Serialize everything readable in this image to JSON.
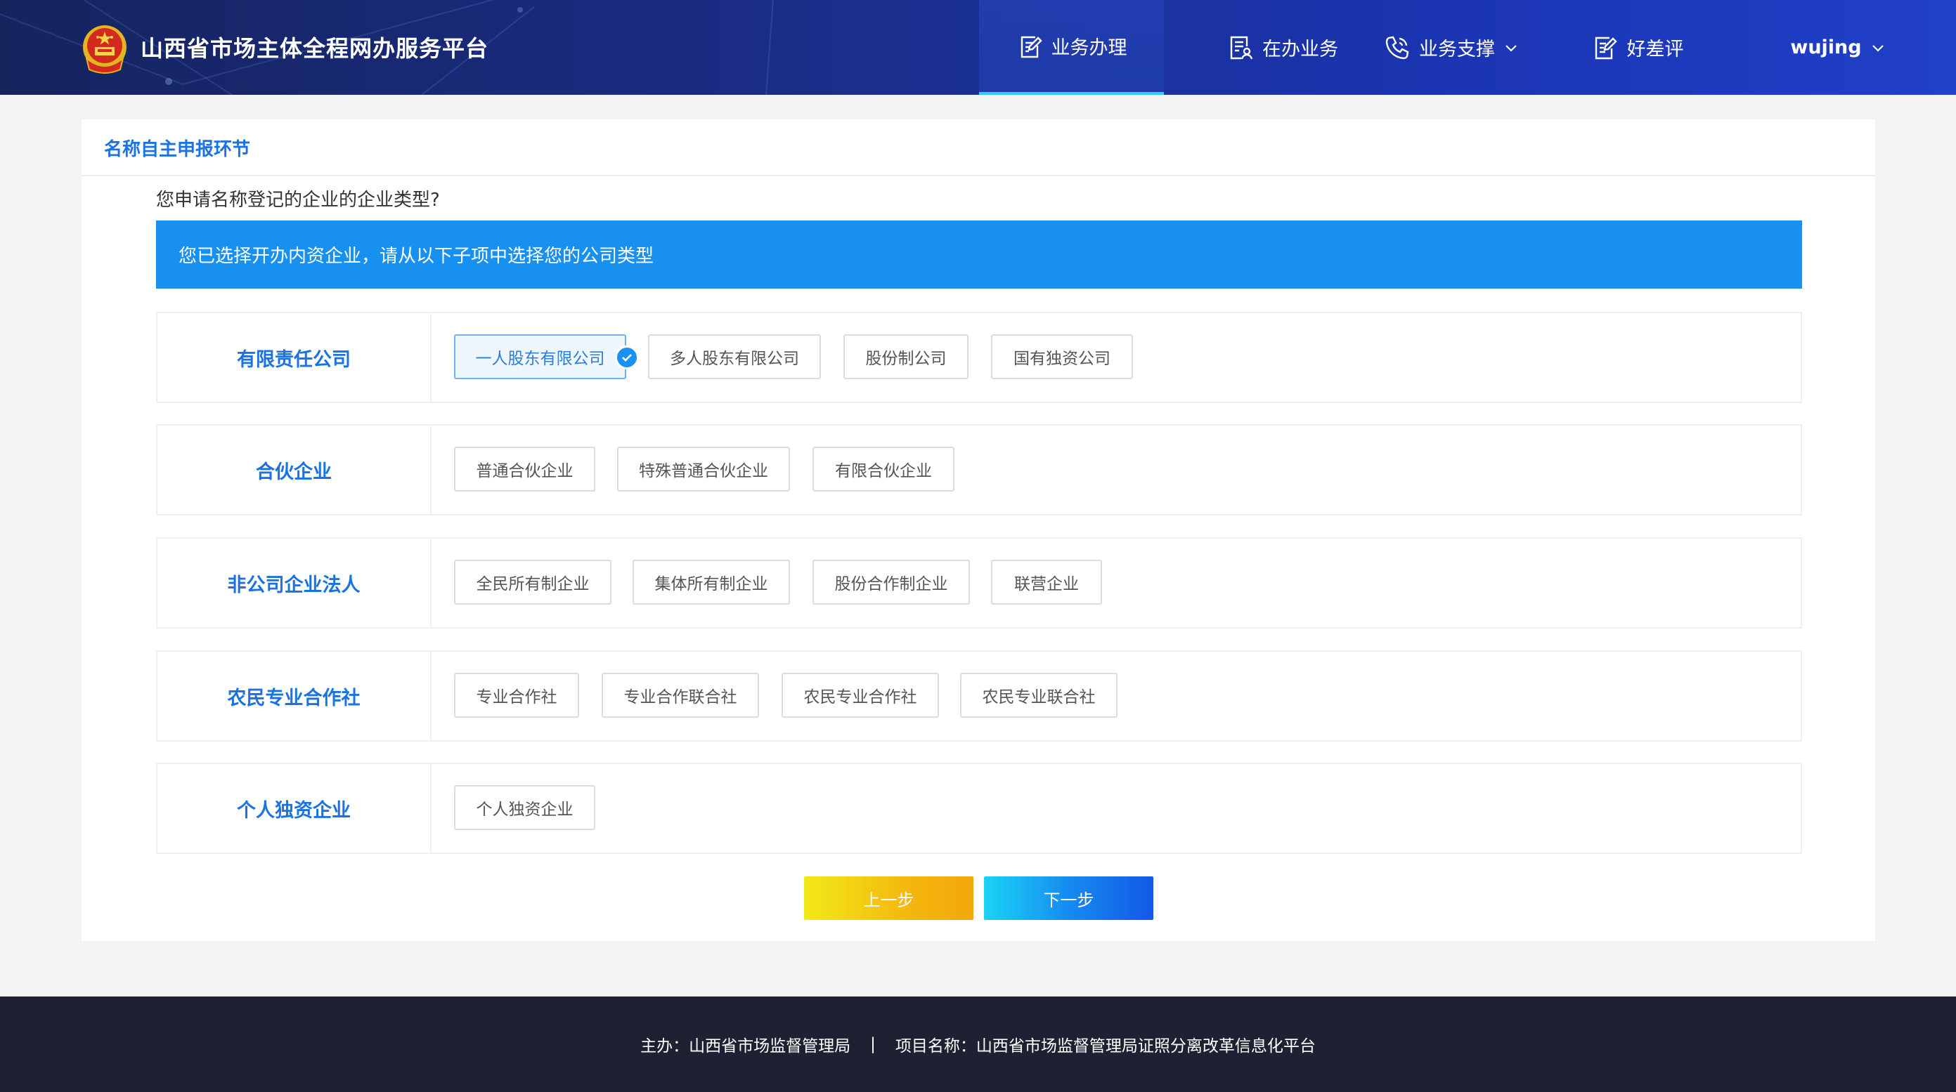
{
  "header": {
    "title": "山西省市场主体全程网办服务平台",
    "nav": [
      {
        "label": "业务办理",
        "icon": "edit-doc-icon"
      },
      {
        "label": "在办业务",
        "icon": "doc-user-icon"
      },
      {
        "label": "业务支撑",
        "icon": "phone-icon"
      },
      {
        "label": "好差评",
        "icon": "rate-doc-icon"
      }
    ],
    "user": "wujing"
  },
  "card": {
    "title": "名称自主申报环节",
    "question": "您申请名称登记的企业的企业类型?",
    "banner": "您已选择开办内资企业，请从以下子项中选择您的公司类型",
    "groups": [
      {
        "label": "有限责任公司",
        "options": [
          "一人股东有限公司",
          "多人股东有限公司",
          "股份制公司",
          "国有独资公司"
        ]
      },
      {
        "label": "合伙企业",
        "options": [
          "普通合伙企业",
          "特殊普通合伙企业",
          "有限合伙企业"
        ]
      },
      {
        "label": "非公司企业法人",
        "options": [
          "全民所有制企业",
          "集体所有制企业",
          "股份合作制企业",
          "联营企业"
        ]
      },
      {
        "label": "农民专业合作社",
        "options": [
          "专业合作社",
          "专业合作联合社",
          "农民专业合作社",
          "农民专业联合社"
        ]
      },
      {
        "label": "个人独资企业",
        "options": [
          "个人独资企业"
        ]
      }
    ],
    "selected": "一人股东有限公司",
    "prev_label": "上一步",
    "next_label": "下一步"
  },
  "footer": {
    "sponsor": "主办：山西省市场监督管理局",
    "separator": "|",
    "project": "项目名称：山西省市场监督管理局证照分离改革信息化平台"
  },
  "colors": {
    "accent": "#1a73e0",
    "banner": "#1890f0",
    "header_start": "#16245e",
    "header_end": "#2040c8",
    "footer": "#1d2131"
  }
}
